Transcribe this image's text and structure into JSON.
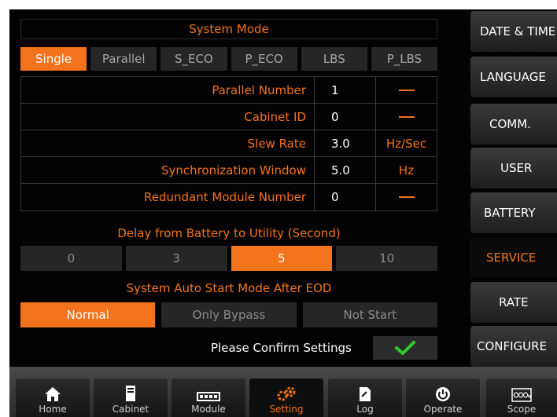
{
  "system_mode": {
    "title": "System Mode",
    "modes": [
      "Single",
      "Parallel",
      "S_ECO",
      "P_ECO",
      "LBS",
      "P_LBS"
    ],
    "selected": "Single"
  },
  "params": [
    {
      "label": "Parallel Number",
      "value": "1",
      "unit": "—"
    },
    {
      "label": "Cabinet ID",
      "value": "0",
      "unit": "—"
    },
    {
      "label": "Slew Rate",
      "value": "3.0",
      "unit": "Hz/Sec"
    },
    {
      "label": "Synchronization Window",
      "value": "5.0",
      "unit": "Hz"
    },
    {
      "label": "Redundant Module Number",
      "value": "0",
      "unit": "—"
    }
  ],
  "delay": {
    "title": "Delay from Battery to Utility (Second)",
    "options": [
      "0",
      "3",
      "5",
      "10"
    ],
    "selected": "5"
  },
  "auto_start": {
    "title": "System Auto Start Mode After EOD",
    "options": [
      "Normal",
      "Only Bypass",
      "Not Start"
    ],
    "selected": "Normal"
  },
  "confirm": {
    "label": "Please Confirm Settings",
    "icon": "checkmark-icon"
  },
  "side_menu": {
    "items": [
      "DATE & TIME",
      "LANGUAGE",
      "COMM.",
      "USER",
      "BATTERY",
      "SERVICE",
      "RATE",
      "CONFIGURE"
    ],
    "active": "SERVICE"
  },
  "toolbar": {
    "items": [
      {
        "label": "Home",
        "icon": "home-icon"
      },
      {
        "label": "Cabinet",
        "icon": "cabinet-icon"
      },
      {
        "label": "Module",
        "icon": "module-icon"
      },
      {
        "label": "Setting",
        "icon": "gear-icon"
      },
      {
        "label": "Log",
        "icon": "log-icon"
      },
      {
        "label": "Operate",
        "icon": "power-icon"
      },
      {
        "label": "Scope",
        "icon": "scope-icon"
      }
    ],
    "active": "Setting"
  },
  "colors": {
    "accent": "#f3731c",
    "confirm_check": "#2ecc2e",
    "background": "#030303"
  }
}
